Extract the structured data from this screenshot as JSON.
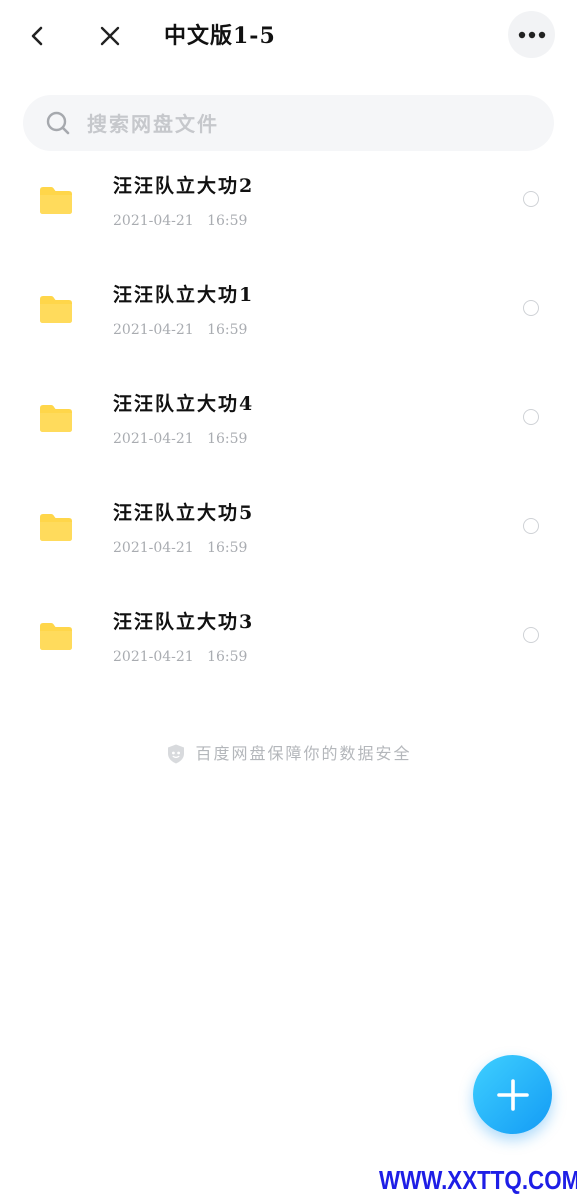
{
  "header": {
    "title": "中文版1-5",
    "back_icon": "chevron-left-icon",
    "close_icon": "close-icon",
    "more_icon": "more-horizontal-icon"
  },
  "search": {
    "placeholder": "搜索网盘文件",
    "value": "",
    "icon": "search-icon"
  },
  "files": [
    {
      "name": "汪汪队立大功2",
      "date": "2021-04-21",
      "time": "16:59",
      "icon": "folder-icon"
    },
    {
      "name": "汪汪队立大功1",
      "date": "2021-04-21",
      "time": "16:59",
      "icon": "folder-icon"
    },
    {
      "name": "汪汪队立大功4",
      "date": "2021-04-21",
      "time": "16:59",
      "icon": "folder-icon"
    },
    {
      "name": "汪汪队立大功5",
      "date": "2021-04-21",
      "time": "16:59",
      "icon": "folder-icon"
    },
    {
      "name": "汪汪队立大功3",
      "date": "2021-04-21",
      "time": "16:59",
      "icon": "folder-icon"
    }
  ],
  "footer": {
    "security_text": "百度网盘保障你的数据安全",
    "icon": "shield-icon"
  },
  "fab": {
    "icon": "plus-icon"
  },
  "watermark": {
    "text": "WWW.XXTTQ.COM"
  },
  "colors": {
    "folder": "#FFD64A",
    "fab_start": "#3FD0FF",
    "fab_end": "#139BF5",
    "meta_text": "#A9ACB1",
    "watermark": "#1E1EE6"
  }
}
